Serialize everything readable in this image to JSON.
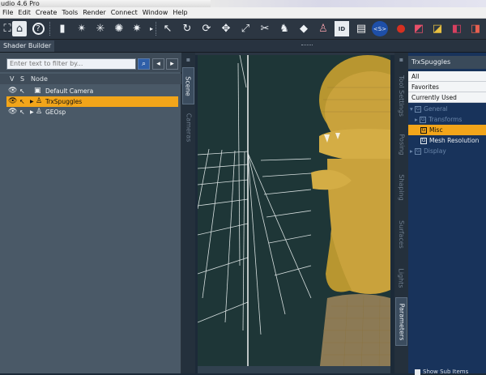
{
  "window": {
    "title": "udio 4.6 Pro"
  },
  "menu": [
    "File",
    "Edit",
    "Create",
    "Tools",
    "Render",
    "Connect",
    "Window",
    "Help"
  ],
  "toolbar": {
    "icons": [
      "frame-icon",
      "home-icon",
      "help-icon",
      "camera-add-icon",
      "light-add-icon",
      "light-add-icon",
      "light-add-icon",
      "light-add-icon",
      "light-add-icon",
      "more-icon",
      "pointer-icon",
      "rotate-icon",
      "universal-icon",
      "translate-icon",
      "scale-icon",
      "joint-icon",
      "node-icon",
      "surface-icon",
      "figure-icon",
      "document-icon",
      "render-settings-icon",
      "shader-icon",
      "render-icon",
      "render-to-icon",
      "render-library-icon",
      "render-settings2-icon",
      "smart-content-icon"
    ],
    "id_label": "ID"
  },
  "shader_builder": {
    "tab": "Shader Builder"
  },
  "scene": {
    "filter_placeholder": "Enter text to filter by...",
    "headers": {
      "visible": "V",
      "selectable": "S",
      "node": "Node"
    },
    "nodes": [
      {
        "label": "Default Camera",
        "selected": false
      },
      {
        "label": "TrxSpuggles",
        "selected": true
      },
      {
        "label": "GEOsp",
        "selected": false
      }
    ]
  },
  "left_tabs": {
    "scene": "Scene",
    "cameras": "Cameras"
  },
  "right_tabs": [
    "Tool Settings",
    "Posing",
    "Shaping",
    "Surfaces",
    "Lights",
    "Parameters"
  ],
  "parameters": {
    "title": "TrxSpuggles",
    "filters": [
      "All",
      "Favorites",
      "Currently Used"
    ],
    "tree": [
      {
        "label": "General",
        "indent": 0,
        "state": "dim"
      },
      {
        "label": "Transforms",
        "indent": 1,
        "state": "dim"
      },
      {
        "label": "Misc",
        "indent": 1,
        "state": "selected"
      },
      {
        "label": "Mesh Resolution",
        "indent": 1,
        "state": "normal"
      },
      {
        "label": "Display",
        "indent": 0,
        "state": "dim"
      }
    ],
    "show_sub_items": "Show Sub Items"
  },
  "colors": {
    "accent": "#f2a51a",
    "panel_blue": "#18335b",
    "figure": "#c9a23c",
    "viewport_bg": "#1e3637"
  }
}
